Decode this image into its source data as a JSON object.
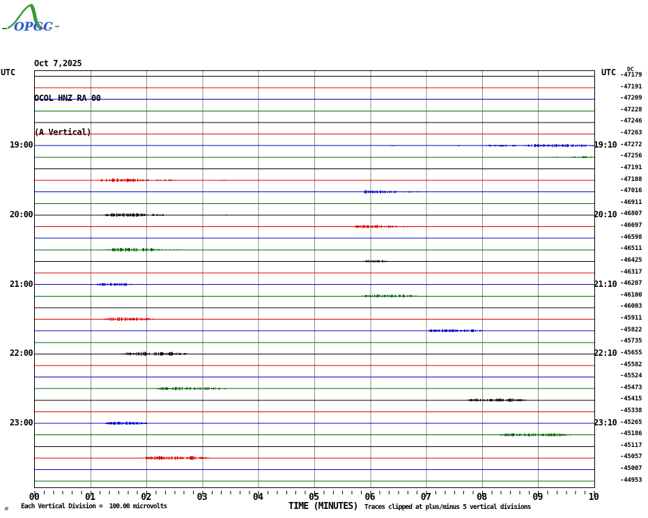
{
  "logo": {
    "text": "OPGC"
  },
  "header": {
    "date": "Oct 7,2025",
    "station": "OCOL HNZ RA 00",
    "component": "(A Vertical)"
  },
  "axis": {
    "left_utc": "UTC",
    "right_utc": "UTC",
    "dc_label": "DC"
  },
  "footer": {
    "corner_glyph": "m",
    "scale_note": "Each Vertical Division =  100.00 microvolts",
    "clip_note": "Traces clipped at plus/minus 5 vertical divisions"
  },
  "chart_data": {
    "type": "line",
    "subtype": "helicorder",
    "title": "OCOL HNZ RA 00 (A Vertical) Oct 7,2025",
    "xlabel": "TIME (MINUTES)",
    "x_tick_labels": [
      "00",
      "01",
      "02",
      "03",
      "04",
      "05",
      "06",
      "07",
      "08",
      "09",
      "10"
    ],
    "minutes_per_trace": 10,
    "minor_ticks_per_minute": 6,
    "grid": "vertical-only",
    "colors": {
      "black": "#000000",
      "red": "#dd0000",
      "blue": "#0000cc",
      "green": "#006600",
      "grid": "#8c8c8c"
    },
    "left_time_labels": [
      {
        "row": 7,
        "label": "19:00"
      },
      {
        "row": 13,
        "label": "20:00"
      },
      {
        "row": 19,
        "label": "21:00"
      },
      {
        "row": 25,
        "label": "22:00"
      },
      {
        "row": 31,
        "label": "23:00"
      }
    ],
    "right_time_labels": [
      {
        "row": 7,
        "label": "19:10"
      },
      {
        "row": 13,
        "label": "20:10"
      },
      {
        "row": 19,
        "label": "21:10"
      },
      {
        "row": 25,
        "label": "22:10"
      },
      {
        "row": 31,
        "label": "23:10"
      }
    ],
    "traces": [
      {
        "row": 1,
        "color": "black",
        "dc": "-47179",
        "bursts": []
      },
      {
        "row": 2,
        "color": "red",
        "dc": "-47191",
        "bursts": []
      },
      {
        "row": 3,
        "color": "blue",
        "dc": "-47209",
        "bursts": []
      },
      {
        "row": 4,
        "color": "green",
        "dc": "-47228",
        "bursts": []
      },
      {
        "row": 5,
        "color": "black",
        "dc": "-47246",
        "bursts": []
      },
      {
        "row": 6,
        "color": "red",
        "dc": "-47263",
        "bursts": []
      },
      {
        "row": 7,
        "color": "blue",
        "dc": "-47272",
        "bursts": [
          {
            "from": 6.35,
            "to": 6.45,
            "amp": 1
          },
          {
            "from": 7.55,
            "to": 7.65,
            "amp": 1
          },
          {
            "from": 8.0,
            "to": 8.7,
            "amp": 1.5
          },
          {
            "from": 8.7,
            "to": 10.0,
            "amp": 2.5
          }
        ]
      },
      {
        "row": 8,
        "color": "green",
        "dc": "-47256",
        "bursts": [
          {
            "from": 9.25,
            "to": 9.4,
            "amp": 1
          },
          {
            "from": 9.5,
            "to": 10.0,
            "amp": 1.5
          }
        ]
      },
      {
        "row": 9,
        "color": "black",
        "dc": "-47191",
        "bursts": []
      },
      {
        "row": 10,
        "color": "red",
        "dc": "-47108",
        "bursts": [
          {
            "from": 1.1,
            "to": 2.05,
            "amp": 3
          },
          {
            "from": 2.05,
            "to": 2.55,
            "amp": 1.5
          },
          {
            "from": 3.35,
            "to": 3.45,
            "amp": 1
          }
        ]
      },
      {
        "row": 11,
        "color": "blue",
        "dc": "-47016",
        "bursts": [
          {
            "from": 5.8,
            "to": 6.55,
            "amp": 2.5
          },
          {
            "from": 6.55,
            "to": 6.9,
            "amp": 1.2
          }
        ]
      },
      {
        "row": 12,
        "color": "green",
        "dc": "-46911",
        "bursts": []
      },
      {
        "row": 13,
        "color": "black",
        "dc": "-46807",
        "bursts": [
          {
            "from": 1.2,
            "to": 2.05,
            "amp": 3
          },
          {
            "from": 2.05,
            "to": 2.35,
            "amp": 1.5
          },
          {
            "from": 3.4,
            "to": 3.5,
            "amp": 1
          }
        ]
      },
      {
        "row": 14,
        "color": "red",
        "dc": "-46697",
        "bursts": [
          {
            "from": 5.65,
            "to": 6.55,
            "amp": 2.5
          },
          {
            "from": 6.55,
            "to": 6.7,
            "amp": 1
          }
        ]
      },
      {
        "row": 15,
        "color": "blue",
        "dc": "-46598",
        "bursts": []
      },
      {
        "row": 16,
        "color": "green",
        "dc": "-46511",
        "bursts": [
          {
            "from": 1.25,
            "to": 2.3,
            "amp": 3
          },
          {
            "from": 2.3,
            "to": 2.65,
            "amp": 1.2
          }
        ]
      },
      {
        "row": 17,
        "color": "black",
        "dc": "-46425",
        "bursts": [
          {
            "from": 5.85,
            "to": 6.35,
            "amp": 2
          }
        ]
      },
      {
        "row": 18,
        "color": "red",
        "dc": "-46317",
        "bursts": []
      },
      {
        "row": 19,
        "color": "blue",
        "dc": "-46207",
        "bursts": [
          {
            "from": 1.05,
            "to": 1.75,
            "amp": 2.5
          }
        ]
      },
      {
        "row": 20,
        "color": "green",
        "dc": "-46100",
        "bursts": [
          {
            "from": 5.8,
            "to": 6.85,
            "amp": 2.5
          }
        ]
      },
      {
        "row": 21,
        "color": "black",
        "dc": "-46003",
        "bursts": []
      },
      {
        "row": 22,
        "color": "red",
        "dc": "-45911",
        "bursts": [
          {
            "from": 1.2,
            "to": 2.15,
            "amp": 3
          }
        ]
      },
      {
        "row": 23,
        "color": "blue",
        "dc": "-45822",
        "bursts": [
          {
            "from": 6.95,
            "to": 8.05,
            "amp": 2.5
          }
        ]
      },
      {
        "row": 24,
        "color": "green",
        "dc": "-45735",
        "bursts": []
      },
      {
        "row": 25,
        "color": "black",
        "dc": "-45655",
        "bursts": [
          {
            "from": 1.5,
            "to": 2.75,
            "amp": 3
          }
        ]
      },
      {
        "row": 26,
        "color": "red",
        "dc": "-45582",
        "bursts": []
      },
      {
        "row": 27,
        "color": "blue",
        "dc": "-45524",
        "bursts": []
      },
      {
        "row": 28,
        "color": "green",
        "dc": "-45473",
        "bursts": [
          {
            "from": 2.1,
            "to": 3.45,
            "amp": 2.5
          }
        ]
      },
      {
        "row": 29,
        "color": "black",
        "dc": "-45415",
        "bursts": [
          {
            "from": 7.65,
            "to": 8.85,
            "amp": 2.5
          }
        ]
      },
      {
        "row": 30,
        "color": "red",
        "dc": "-45338",
        "bursts": []
      },
      {
        "row": 31,
        "color": "blue",
        "dc": "-45265",
        "bursts": [
          {
            "from": 1.2,
            "to": 2.05,
            "amp": 2.5
          }
        ]
      },
      {
        "row": 32,
        "color": "green",
        "dc": "-45186",
        "bursts": [
          {
            "from": 8.2,
            "to": 9.65,
            "amp": 2.5
          }
        ]
      },
      {
        "row": 33,
        "color": "black",
        "dc": "-45117",
        "bursts": []
      },
      {
        "row": 34,
        "color": "red",
        "dc": "-45057",
        "bursts": [
          {
            "from": 1.85,
            "to": 3.15,
            "amp": 3
          }
        ]
      },
      {
        "row": 35,
        "color": "blue",
        "dc": "-45007",
        "bursts": []
      },
      {
        "row": 36,
        "color": "green",
        "dc": "-44953",
        "bursts": []
      }
    ]
  }
}
